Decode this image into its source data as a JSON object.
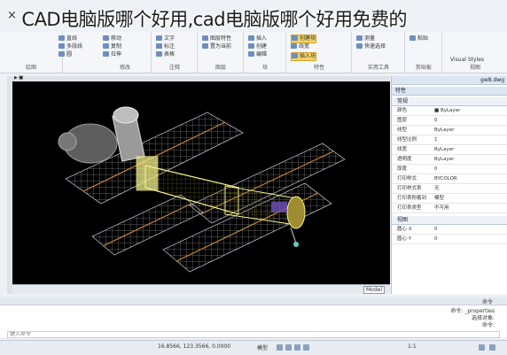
{
  "watermark": {
    "title": "CAD电脑版哪个好用,cad电脑版哪个好用免费的",
    "close_glyph": "×"
  },
  "ribbon": {
    "groups": [
      {
        "label": "绘图",
        "items": [
          "直线",
          "多段线",
          "圆"
        ]
      },
      {
        "label": "修改",
        "items": [
          "移动",
          "复制",
          "拉伸"
        ]
      },
      {
        "label": "注释",
        "items": [
          "文字",
          "标注",
          "表格"
        ]
      },
      {
        "label": "图层",
        "items": [
          "图层特性",
          "置为当前",
          "匹配"
        ]
      },
      {
        "label": "块",
        "items": [
          "插入",
          "创建",
          "编辑"
        ]
      },
      {
        "label": "特性",
        "items": [
          "特性匹配",
          "线宽",
          "颜色"
        ]
      },
      {
        "label": "组",
        "items": [
          "组",
          "解组"
        ]
      },
      {
        "label": "实用工具",
        "items": [
          "测量",
          "快速选择"
        ]
      },
      {
        "label": "剪贴板",
        "items": [
          "粘贴"
        ]
      },
      {
        "label": "视图",
        "items": [
          "Visual Styles"
        ]
      }
    ],
    "highlighted": [
      "创建块",
      "插入块"
    ]
  },
  "drawing_tab": "gw8.dwg",
  "viewport": {
    "background": "#000000",
    "model_label": "Model",
    "status": "ProduceMag"
  },
  "properties": {
    "header": "特性",
    "section_general": "常规",
    "rows": [
      {
        "k": "颜色",
        "v": "■ ByLayer"
      },
      {
        "k": "图层",
        "v": "0"
      },
      {
        "k": "线型",
        "v": "ByLayer"
      },
      {
        "k": "线型比例",
        "v": "1"
      },
      {
        "k": "线宽",
        "v": "ByLayer"
      },
      {
        "k": "透明度",
        "v": "ByLayer"
      },
      {
        "k": "厚度",
        "v": "0"
      },
      {
        "k": "打印样式",
        "v": "BYCOLOR"
      },
      {
        "k": "打印样式表",
        "v": "无"
      },
      {
        "k": "打印表附着到",
        "v": "模型"
      },
      {
        "k": "打印表类型",
        "v": "不可用"
      }
    ],
    "section_view": "视图",
    "view_rows": [
      {
        "k": "圆心 X",
        "v": "0"
      },
      {
        "k": "圆心 Y",
        "v": "0"
      }
    ]
  },
  "command": {
    "header": "命令",
    "lines": [
      "命令: _properties",
      "选择对象:",
      "命令:"
    ],
    "placeholder": "键入命令"
  },
  "statusbar": {
    "coords": "16.8566, 123.3566, 0.0000",
    "mode": "模型",
    "scale": "1:1"
  },
  "colors": {
    "space_station": "#f3f08a",
    "solar_panel": "#c9cdd6",
    "accent": "#e8a13b"
  }
}
